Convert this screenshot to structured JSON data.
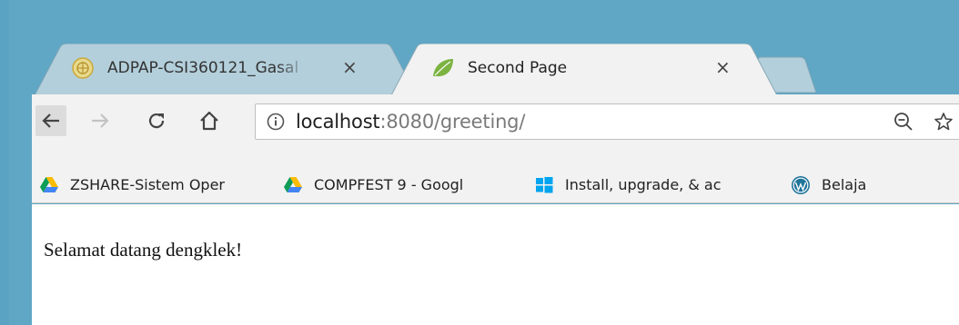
{
  "tabs": [
    {
      "title": "ADPAP-CSI360121_Gasal",
      "active": false,
      "close": "×"
    },
    {
      "title": "Second Page",
      "active": true,
      "close": "×"
    }
  ],
  "toolbar": {
    "url_host": "localhost",
    "url_rest": ":8080/greeting/"
  },
  "bookmarks": [
    {
      "label": "ZSHARE-Sistem Oper",
      "icon": "google-drive-icon"
    },
    {
      "label": "COMPFEST 9 - Googl",
      "icon": "google-drive-icon"
    },
    {
      "label": "Install, upgrade, & ac",
      "icon": "windows-icon"
    },
    {
      "label": "Belaja",
      "icon": "wordpress-icon"
    }
  ],
  "page": {
    "greeting": "Selamat datang dengklek!"
  },
  "colors": {
    "frame": "#5fa7c5",
    "toolbar": "#f2f2f2",
    "inactive_tab": "#b3cfdb",
    "active_tab": "#f2f2f2"
  }
}
